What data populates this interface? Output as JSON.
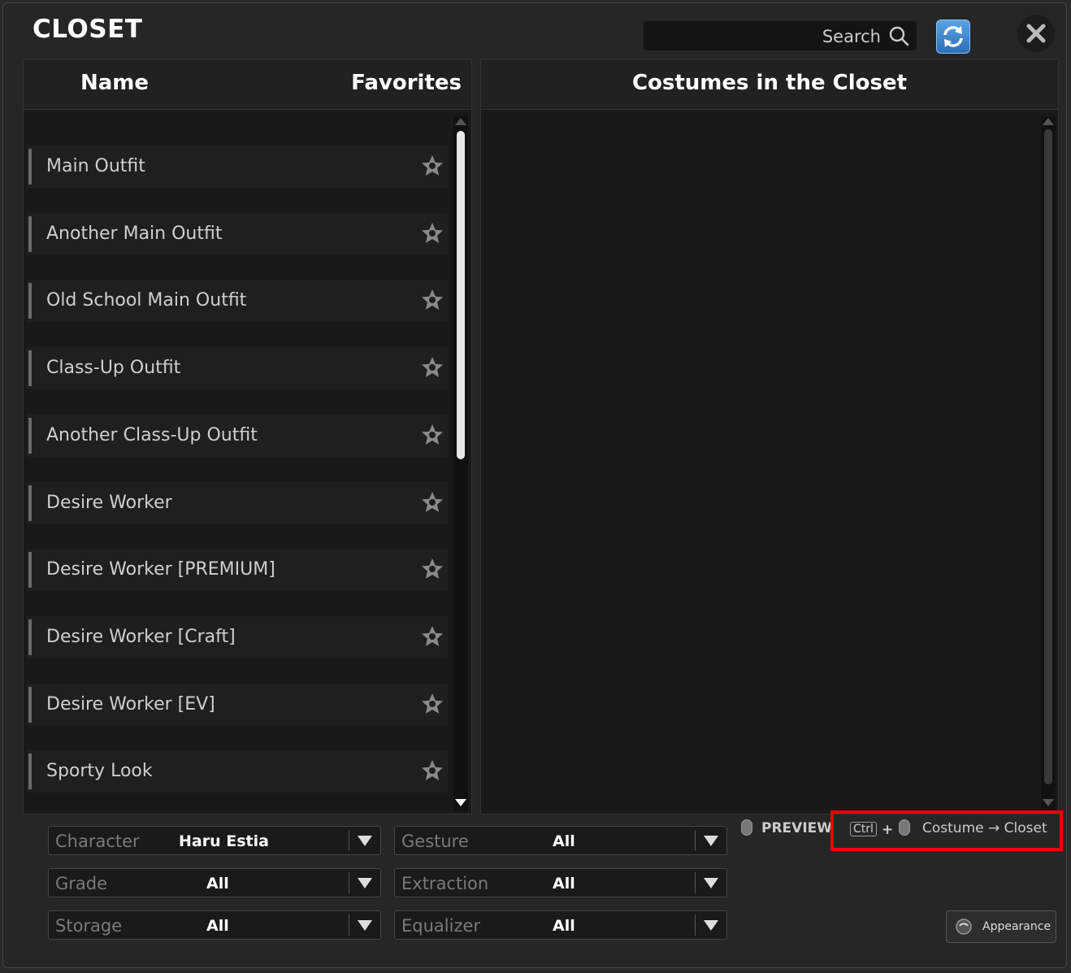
{
  "window": {
    "title": "CLOSET"
  },
  "search": {
    "label": "Search"
  },
  "left_panel": {
    "col_name": "Name",
    "col_favorites": "Favorites",
    "items": [
      "Main Outfit",
      "Another Main Outfit",
      "Old School Main Outfit",
      "Class-Up Outfit",
      "Another Class-Up Outfit",
      "Desire Worker",
      "Desire Worker [PREMIUM]",
      "Desire Worker [Craft]",
      "Desire Worker [EV]",
      "Sporty Look"
    ]
  },
  "right_panel": {
    "title": "Costumes in the Closet"
  },
  "filters": {
    "character": {
      "label": "Character",
      "value": "Haru Estia"
    },
    "grade": {
      "label": "Grade",
      "value": "All"
    },
    "storage": {
      "label": "Storage",
      "value": "All"
    },
    "gesture": {
      "label": "Gesture",
      "value": "All"
    },
    "extraction": {
      "label": "Extraction",
      "value": "All"
    },
    "equalizer": {
      "label": "Equalizer",
      "value": "All"
    }
  },
  "hints": {
    "preview": "PREVIEW",
    "ctrl": "Ctrl",
    "plus": "+",
    "costume_to_closet": "Costume → Closet"
  },
  "appearance_button": {
    "label": "Appearance"
  },
  "colors": {
    "accent_blue": "#3b86d1",
    "highlight_red": "#ee0000",
    "background": "#262626"
  }
}
